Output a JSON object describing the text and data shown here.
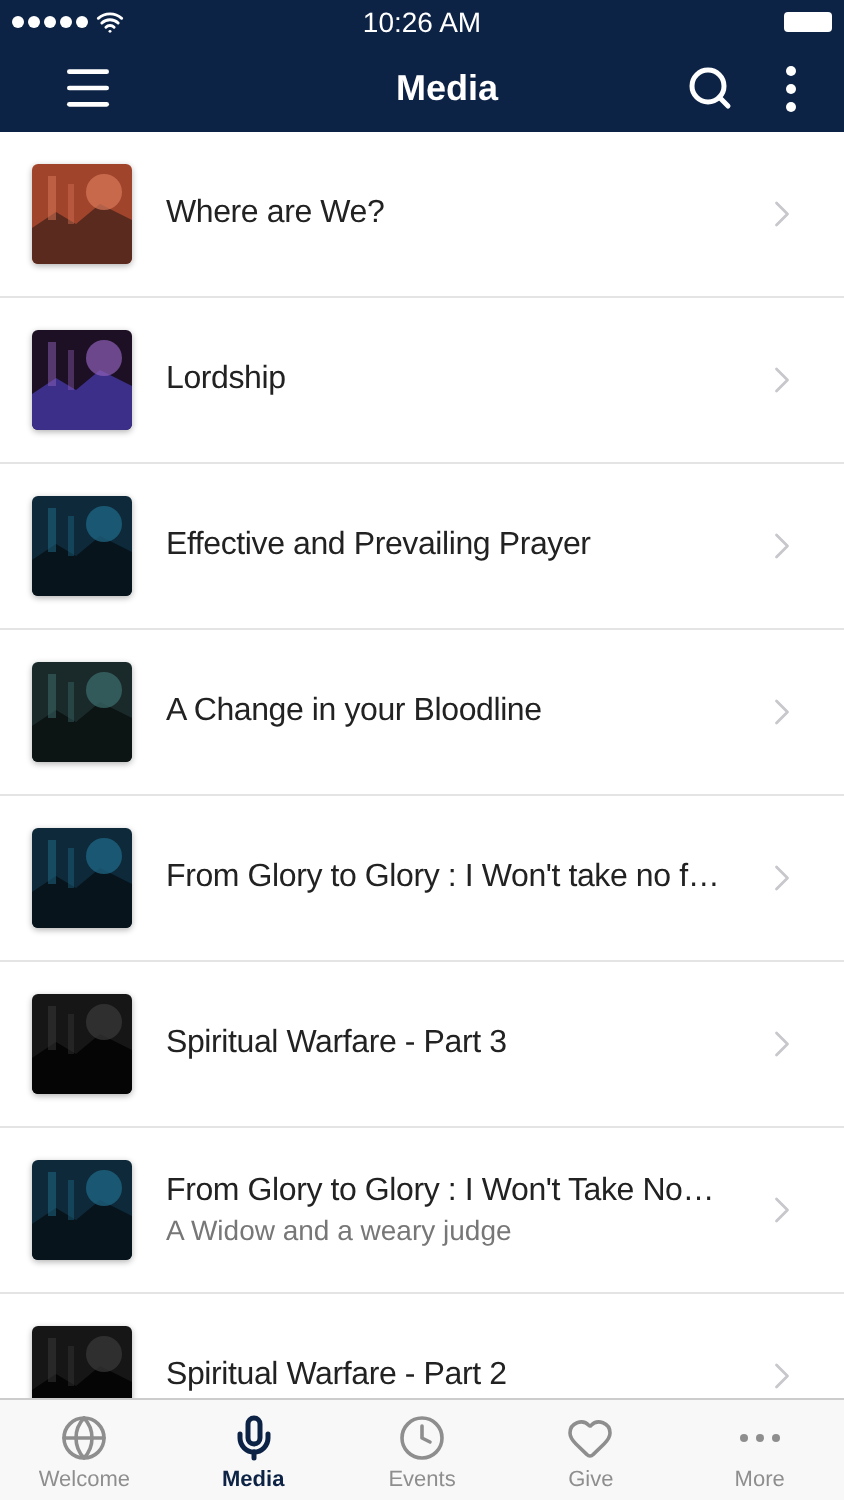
{
  "status_bar": {
    "time": "10:26 AM"
  },
  "header": {
    "title": "Media"
  },
  "media_items": [
    {
      "title": "Where are We?"
    },
    {
      "title": "Lordship"
    },
    {
      "title": "Effective and Prevailing Prayer"
    },
    {
      "title": "A Change in your Bloodline"
    },
    {
      "title": "From Glory to Glory : I Won't take no f…"
    },
    {
      "title": "Spiritual Warfare - Part 3"
    },
    {
      "title": "From Glory to Glory : I Won't Take No…",
      "subtitle": "A Widow and a weary judge"
    },
    {
      "title": "Spiritual Warfare - Part 2"
    }
  ],
  "tab_bar": [
    {
      "label": "Welcome",
      "selected": false
    },
    {
      "label": "Media",
      "selected": true
    },
    {
      "label": "Events",
      "selected": false
    },
    {
      "label": "Give",
      "selected": false
    },
    {
      "label": "More",
      "selected": false
    }
  ]
}
